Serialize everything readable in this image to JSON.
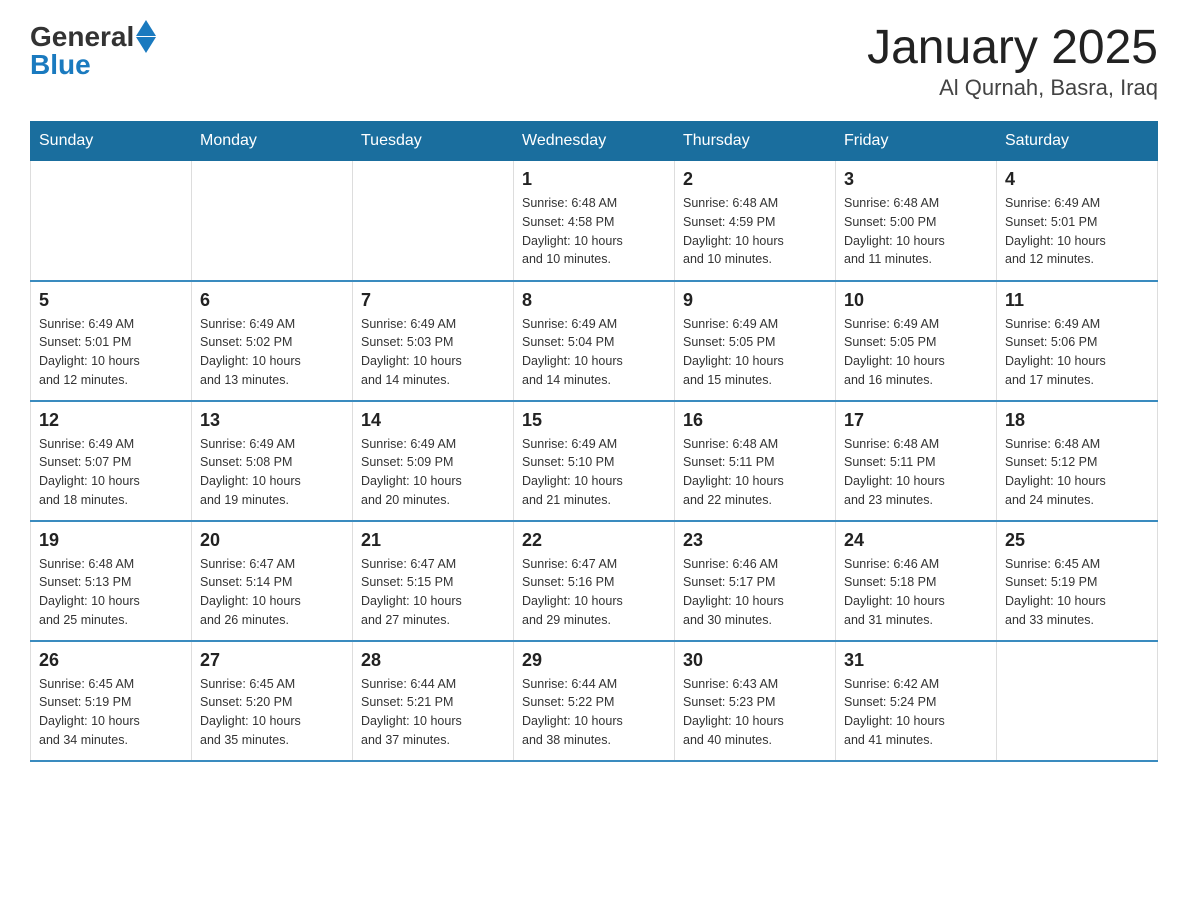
{
  "header": {
    "logo_general": "General",
    "logo_blue": "Blue",
    "title": "January 2025",
    "subtitle": "Al Qurnah, Basra, Iraq"
  },
  "days_of_week": [
    "Sunday",
    "Monday",
    "Tuesday",
    "Wednesday",
    "Thursday",
    "Friday",
    "Saturday"
  ],
  "weeks": [
    {
      "days": [
        {
          "number": "",
          "info": ""
        },
        {
          "number": "",
          "info": ""
        },
        {
          "number": "",
          "info": ""
        },
        {
          "number": "1",
          "info": "Sunrise: 6:48 AM\nSunset: 4:58 PM\nDaylight: 10 hours\nand 10 minutes."
        },
        {
          "number": "2",
          "info": "Sunrise: 6:48 AM\nSunset: 4:59 PM\nDaylight: 10 hours\nand 10 minutes."
        },
        {
          "number": "3",
          "info": "Sunrise: 6:48 AM\nSunset: 5:00 PM\nDaylight: 10 hours\nand 11 minutes."
        },
        {
          "number": "4",
          "info": "Sunrise: 6:49 AM\nSunset: 5:01 PM\nDaylight: 10 hours\nand 12 minutes."
        }
      ]
    },
    {
      "days": [
        {
          "number": "5",
          "info": "Sunrise: 6:49 AM\nSunset: 5:01 PM\nDaylight: 10 hours\nand 12 minutes."
        },
        {
          "number": "6",
          "info": "Sunrise: 6:49 AM\nSunset: 5:02 PM\nDaylight: 10 hours\nand 13 minutes."
        },
        {
          "number": "7",
          "info": "Sunrise: 6:49 AM\nSunset: 5:03 PM\nDaylight: 10 hours\nand 14 minutes."
        },
        {
          "number": "8",
          "info": "Sunrise: 6:49 AM\nSunset: 5:04 PM\nDaylight: 10 hours\nand 14 minutes."
        },
        {
          "number": "9",
          "info": "Sunrise: 6:49 AM\nSunset: 5:05 PM\nDaylight: 10 hours\nand 15 minutes."
        },
        {
          "number": "10",
          "info": "Sunrise: 6:49 AM\nSunset: 5:05 PM\nDaylight: 10 hours\nand 16 minutes."
        },
        {
          "number": "11",
          "info": "Sunrise: 6:49 AM\nSunset: 5:06 PM\nDaylight: 10 hours\nand 17 minutes."
        }
      ]
    },
    {
      "days": [
        {
          "number": "12",
          "info": "Sunrise: 6:49 AM\nSunset: 5:07 PM\nDaylight: 10 hours\nand 18 minutes."
        },
        {
          "number": "13",
          "info": "Sunrise: 6:49 AM\nSunset: 5:08 PM\nDaylight: 10 hours\nand 19 minutes."
        },
        {
          "number": "14",
          "info": "Sunrise: 6:49 AM\nSunset: 5:09 PM\nDaylight: 10 hours\nand 20 minutes."
        },
        {
          "number": "15",
          "info": "Sunrise: 6:49 AM\nSunset: 5:10 PM\nDaylight: 10 hours\nand 21 minutes."
        },
        {
          "number": "16",
          "info": "Sunrise: 6:48 AM\nSunset: 5:11 PM\nDaylight: 10 hours\nand 22 minutes."
        },
        {
          "number": "17",
          "info": "Sunrise: 6:48 AM\nSunset: 5:11 PM\nDaylight: 10 hours\nand 23 minutes."
        },
        {
          "number": "18",
          "info": "Sunrise: 6:48 AM\nSunset: 5:12 PM\nDaylight: 10 hours\nand 24 minutes."
        }
      ]
    },
    {
      "days": [
        {
          "number": "19",
          "info": "Sunrise: 6:48 AM\nSunset: 5:13 PM\nDaylight: 10 hours\nand 25 minutes."
        },
        {
          "number": "20",
          "info": "Sunrise: 6:47 AM\nSunset: 5:14 PM\nDaylight: 10 hours\nand 26 minutes."
        },
        {
          "number": "21",
          "info": "Sunrise: 6:47 AM\nSunset: 5:15 PM\nDaylight: 10 hours\nand 27 minutes."
        },
        {
          "number": "22",
          "info": "Sunrise: 6:47 AM\nSunset: 5:16 PM\nDaylight: 10 hours\nand 29 minutes."
        },
        {
          "number": "23",
          "info": "Sunrise: 6:46 AM\nSunset: 5:17 PM\nDaylight: 10 hours\nand 30 minutes."
        },
        {
          "number": "24",
          "info": "Sunrise: 6:46 AM\nSunset: 5:18 PM\nDaylight: 10 hours\nand 31 minutes."
        },
        {
          "number": "25",
          "info": "Sunrise: 6:45 AM\nSunset: 5:19 PM\nDaylight: 10 hours\nand 33 minutes."
        }
      ]
    },
    {
      "days": [
        {
          "number": "26",
          "info": "Sunrise: 6:45 AM\nSunset: 5:19 PM\nDaylight: 10 hours\nand 34 minutes."
        },
        {
          "number": "27",
          "info": "Sunrise: 6:45 AM\nSunset: 5:20 PM\nDaylight: 10 hours\nand 35 minutes."
        },
        {
          "number": "28",
          "info": "Sunrise: 6:44 AM\nSunset: 5:21 PM\nDaylight: 10 hours\nand 37 minutes."
        },
        {
          "number": "29",
          "info": "Sunrise: 6:44 AM\nSunset: 5:22 PM\nDaylight: 10 hours\nand 38 minutes."
        },
        {
          "number": "30",
          "info": "Sunrise: 6:43 AM\nSunset: 5:23 PM\nDaylight: 10 hours\nand 40 minutes."
        },
        {
          "number": "31",
          "info": "Sunrise: 6:42 AM\nSunset: 5:24 PM\nDaylight: 10 hours\nand 41 minutes."
        },
        {
          "number": "",
          "info": ""
        }
      ]
    }
  ]
}
